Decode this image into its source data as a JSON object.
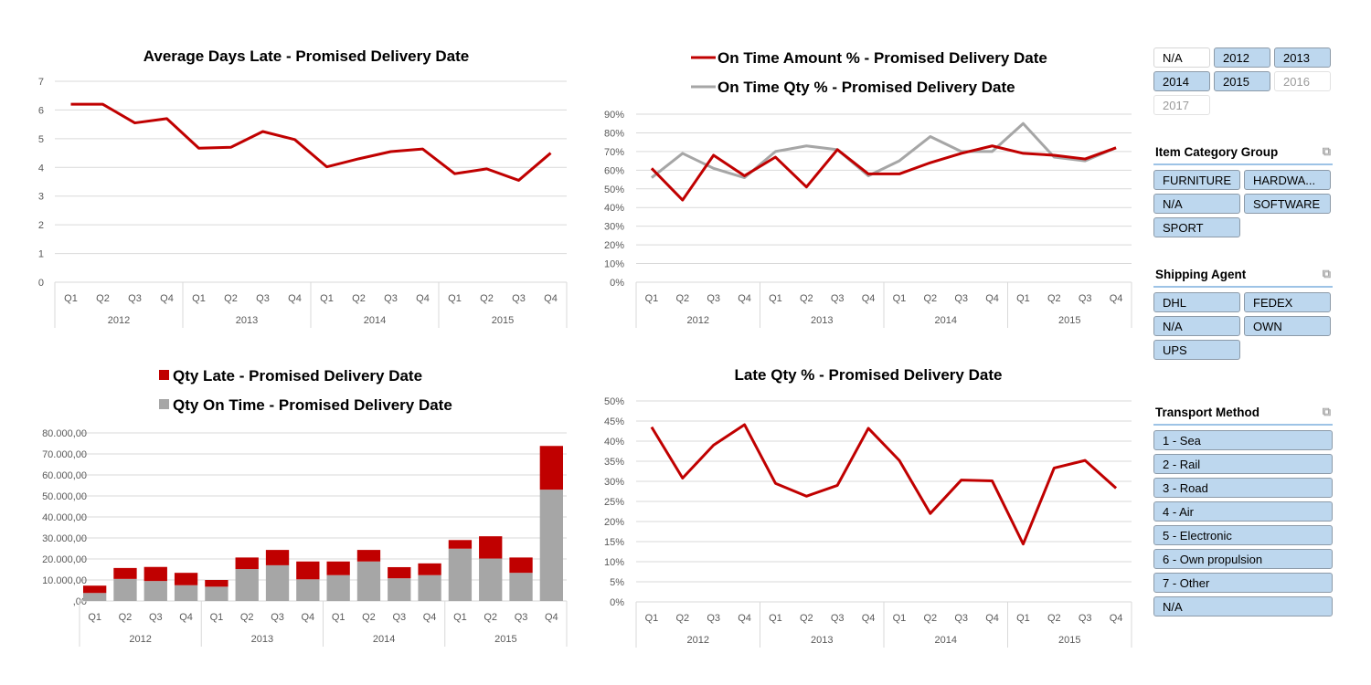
{
  "colors": {
    "red": "#c00000",
    "gray": "#a6a6a6",
    "slicer_selected": "#bdd7ee",
    "slicer_border": "#9dc3e6"
  },
  "chart_data": [
    {
      "id": "avg-days-late",
      "type": "line",
      "title": "Average Days Late - Promised Delivery Date",
      "categories": [
        "Q1",
        "Q2",
        "Q3",
        "Q4",
        "Q1",
        "Q2",
        "Q3",
        "Q4",
        "Q1",
        "Q2",
        "Q3",
        "Q4",
        "Q1",
        "Q2",
        "Q3",
        "Q4"
      ],
      "groups": [
        "2012",
        "2013",
        "2014",
        "2015"
      ],
      "yticks": [
        "0",
        "1",
        "2",
        "3",
        "4",
        "5",
        "6",
        "7"
      ],
      "ylim": [
        0,
        7
      ],
      "series": [
        {
          "name": "Average Days Late",
          "color": "#c00000",
          "values": [
            6.2,
            6.2,
            5.55,
            5.7,
            4.67,
            4.7,
            5.25,
            4.97,
            4.02,
            4.3,
            4.55,
            4.64,
            3.78,
            3.95,
            3.55,
            4.5
          ]
        }
      ],
      "grid": true,
      "legend": "none"
    },
    {
      "id": "on-time-pct",
      "type": "line",
      "title": "",
      "categories": [
        "Q1",
        "Q2",
        "Q3",
        "Q4",
        "Q1",
        "Q2",
        "Q3",
        "Q4",
        "Q1",
        "Q2",
        "Q3",
        "Q4",
        "Q1",
        "Q2",
        "Q3",
        "Q4"
      ],
      "groups": [
        "2012",
        "2013",
        "2014",
        "2015"
      ],
      "yticks": [
        "0%",
        "10%",
        "20%",
        "30%",
        "40%",
        "50%",
        "60%",
        "70%",
        "80%",
        "90%"
      ],
      "ylim": [
        0,
        90
      ],
      "series": [
        {
          "name": "On Time Amount % - Promised Delivery Date",
          "color": "#c00000",
          "values": [
            61,
            44,
            68,
            57,
            67,
            51,
            71,
            58,
            58,
            64,
            69,
            73,
            69,
            68,
            66,
            72
          ]
        },
        {
          "name": "On Time Qty % - Promised Delivery Date",
          "color": "#a6a6a6",
          "values": [
            56,
            69,
            61,
            56,
            70,
            73,
            71,
            57,
            65,
            78,
            70,
            70,
            85,
            67,
            65,
            72
          ]
        }
      ],
      "grid": true,
      "legend": "top"
    },
    {
      "id": "qty-stacked",
      "type": "bar",
      "title": "",
      "stacked": true,
      "categories": [
        "Q1",
        "Q2",
        "Q3",
        "Q4",
        "Q1",
        "Q2",
        "Q3",
        "Q4",
        "Q1",
        "Q2",
        "Q3",
        "Q4",
        "Q1",
        "Q2",
        "Q3",
        "Q4"
      ],
      "groups": [
        "2012",
        "2013",
        "2014",
        "2015"
      ],
      "yticks": [
        ",00",
        "10.000,00",
        "20.000,00",
        "30.000,00",
        "40.000,00",
        "50.000,00",
        "60.000,00",
        "70.000,00",
        "80.000,00"
      ],
      "ylim": [
        0,
        80000
      ],
      "series": [
        {
          "name": "Qty On Time - Promised Delivery Date",
          "color": "#a6a6a6",
          "values": [
            3800,
            10500,
            9500,
            7500,
            6800,
            15200,
            17000,
            10300,
            12300,
            18800,
            10800,
            12300,
            24900,
            20200,
            13400,
            53000
          ]
        },
        {
          "name": "Qty Late - Promised Delivery Date",
          "color": "#c00000",
          "values": [
            3500,
            5200,
            6700,
            5900,
            3200,
            5500,
            7300,
            8500,
            6500,
            5500,
            5300,
            5600,
            4100,
            10600,
            7300,
            20800
          ]
        }
      ],
      "legend_order": [
        "Qty Late - Promised Delivery Date",
        "Qty On Time - Promised Delivery Date"
      ],
      "grid": true,
      "legend": "top"
    },
    {
      "id": "late-qty-pct",
      "type": "line",
      "title": "Late Qty % - Promised Delivery Date",
      "categories": [
        "Q1",
        "Q2",
        "Q3",
        "Q4",
        "Q1",
        "Q2",
        "Q3",
        "Q4",
        "Q1",
        "Q2",
        "Q3",
        "Q4",
        "Q1",
        "Q2",
        "Q3",
        "Q4"
      ],
      "groups": [
        "2012",
        "2013",
        "2014",
        "2015"
      ],
      "yticks": [
        "0%",
        "5%",
        "10%",
        "15%",
        "20%",
        "25%",
        "30%",
        "35%",
        "40%",
        "45%",
        "50%"
      ],
      "ylim": [
        0,
        50
      ],
      "series": [
        {
          "name": "Late Qty %",
          "color": "#c00000",
          "values": [
            43.5,
            30.8,
            39,
            44.1,
            29.5,
            26.3,
            29,
            43.2,
            35.2,
            22,
            30.3,
            30.1,
            14.4,
            33.3,
            35.2,
            28.3
          ]
        }
      ],
      "grid": true,
      "legend": "none"
    }
  ],
  "slicers": {
    "year": {
      "items": [
        {
          "label": "N/A",
          "state": "unselected"
        },
        {
          "label": "2012",
          "state": "selected"
        },
        {
          "label": "2013",
          "state": "selected"
        },
        {
          "label": "2014",
          "state": "selected"
        },
        {
          "label": "2015",
          "state": "selected"
        },
        {
          "label": "2016",
          "state": "nodata"
        },
        {
          "label": "2017",
          "state": "nodata"
        }
      ]
    },
    "item_category_group": {
      "title": "Item Category Group",
      "clear_icon": "clear-filter-icon",
      "items": [
        {
          "label": "FURNITURE",
          "state": "selected"
        },
        {
          "label": "HARDWA...",
          "state": "selected"
        },
        {
          "label": "N/A",
          "state": "selected"
        },
        {
          "label": "SOFTWARE",
          "state": "selected"
        },
        {
          "label": "SPORT",
          "state": "selected"
        }
      ]
    },
    "shipping_agent": {
      "title": "Shipping Agent",
      "clear_icon": "clear-filter-icon",
      "items": [
        {
          "label": "DHL",
          "state": "selected"
        },
        {
          "label": "FEDEX",
          "state": "selected"
        },
        {
          "label": "N/A",
          "state": "selected"
        },
        {
          "label": "OWN",
          "state": "selected"
        },
        {
          "label": "UPS",
          "state": "selected"
        }
      ]
    },
    "transport_method": {
      "title": "Transport Method",
      "clear_icon": "clear-filter-icon",
      "items": [
        {
          "label": "1 - Sea",
          "state": "selected"
        },
        {
          "label": "2 - Rail",
          "state": "selected"
        },
        {
          "label": "3 - Road",
          "state": "selected"
        },
        {
          "label": "4 - Air",
          "state": "selected"
        },
        {
          "label": "5 - Electronic",
          "state": "selected"
        },
        {
          "label": "6 - Own propulsion",
          "state": "selected"
        },
        {
          "label": "7 - Other",
          "state": "selected"
        },
        {
          "label": "N/A",
          "state": "selected"
        }
      ]
    }
  }
}
